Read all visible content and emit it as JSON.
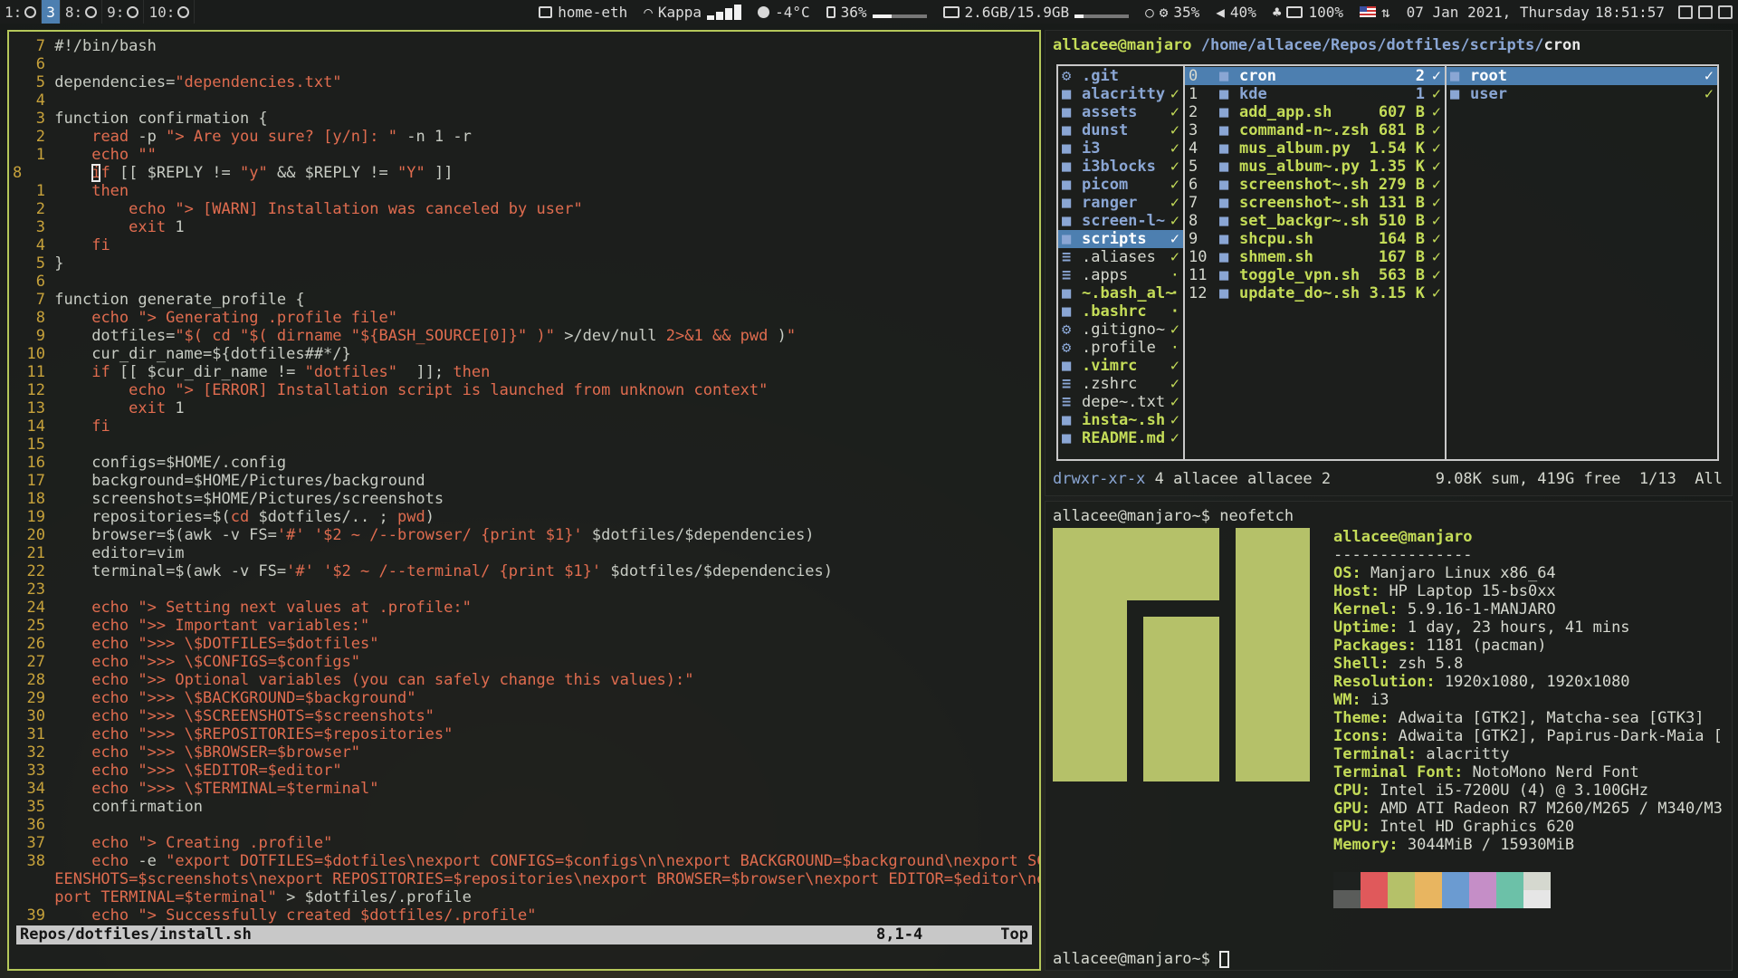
{
  "topbar": {
    "workspaces": [
      {
        "label": "1:",
        "icon": "terminal-icon",
        "active": false
      },
      {
        "label": "3",
        "icon": "",
        "active": true
      },
      {
        "label": "8:",
        "icon": "image-icon",
        "active": false
      },
      {
        "label": "9:",
        "icon": "music-icon",
        "active": false
      },
      {
        "label": "10:",
        "icon": "browser-icon",
        "active": false
      }
    ],
    "network": "home-eth",
    "wifi": "Kappa",
    "wifi_signal": 4,
    "weather": "-4°C",
    "battery_pct": "36%",
    "battery_level": 0.36,
    "memory": "2.6GB/15.9GB",
    "memory_level": 0.16,
    "cpu": "35%",
    "volume": "40%",
    "power": "100%",
    "datetime": "07 Jan 2021, Thursday",
    "time": "18:51:57"
  },
  "vim": {
    "lines": [
      {
        "n": "7",
        "h": [
          [
            "d",
            "#!/bin/bash"
          ]
        ]
      },
      {
        "n": "6",
        "h": []
      },
      {
        "n": "5",
        "h": [
          [
            "d",
            "dependencies="
          ],
          [
            "s",
            "\"dependencies.txt\""
          ]
        ]
      },
      {
        "n": "4",
        "h": []
      },
      {
        "n": "3",
        "h": [
          [
            "d",
            "function confirmation {"
          ]
        ]
      },
      {
        "n": "2",
        "h": [
          [
            "d",
            "    "
          ],
          [
            "k",
            "read"
          ],
          [
            "d",
            " -p "
          ],
          [
            "s",
            "\"> Are you sure? [y/n]: \""
          ],
          [
            "d",
            " -n 1 -r"
          ]
        ]
      },
      {
        "n": "1",
        "h": [
          [
            "d",
            "    "
          ],
          [
            "k",
            "echo"
          ],
          [
            "d",
            " "
          ],
          [
            "s",
            "\"\""
          ]
        ]
      },
      {
        "n": "8",
        "cur": true,
        "h": [
          [
            "d",
            "    "
          ],
          [
            "c",
            "i"
          ],
          [
            "k",
            "f"
          ],
          [
            "d",
            " [[ $REPLY != "
          ],
          [
            "s",
            "\"y\""
          ],
          [
            "d",
            " && $REPLY != "
          ],
          [
            "s",
            "\"Y\""
          ],
          [
            "d",
            " ]]"
          ]
        ]
      },
      {
        "n": "1",
        "h": [
          [
            "d",
            "    "
          ],
          [
            "k",
            "then"
          ]
        ]
      },
      {
        "n": "2",
        "h": [
          [
            "d",
            "        "
          ],
          [
            "k",
            "echo"
          ],
          [
            "d",
            " "
          ],
          [
            "s",
            "\"> [WARN] Installation was canceled by user\""
          ]
        ]
      },
      {
        "n": "3",
        "h": [
          [
            "d",
            "        "
          ],
          [
            "k",
            "exit"
          ],
          [
            "d",
            " 1"
          ]
        ]
      },
      {
        "n": "4",
        "h": [
          [
            "d",
            "    "
          ],
          [
            "k",
            "fi"
          ]
        ]
      },
      {
        "n": "5",
        "h": [
          [
            "d",
            "}"
          ]
        ]
      },
      {
        "n": "6",
        "h": []
      },
      {
        "n": "7",
        "h": [
          [
            "d",
            "function generate_profile {"
          ]
        ]
      },
      {
        "n": "8",
        "h": [
          [
            "d",
            "    "
          ],
          [
            "k",
            "echo"
          ],
          [
            "d",
            " "
          ],
          [
            "s",
            "\"> Generating .profile file\""
          ]
        ]
      },
      {
        "n": "9",
        "h": [
          [
            "d",
            "    dotfiles="
          ],
          [
            "s",
            "\"$( cd \"$( dirname \"${BASH_SOURCE[0]}\" )\""
          ],
          [
            "d",
            " >/dev/null "
          ],
          [
            "s",
            "2>&1 && pwd"
          ],
          [
            "d",
            " )"
          ],
          [
            "s",
            "\""
          ]
        ]
      },
      {
        "n": "10",
        "h": [
          [
            "d",
            "    cur_dir_name=${dotfiles##*/}"
          ]
        ]
      },
      {
        "n": "11",
        "h": [
          [
            "d",
            "    "
          ],
          [
            "k",
            "if"
          ],
          [
            "d",
            " [[ $cur_dir_name != "
          ],
          [
            "s",
            "\"dotfiles\""
          ],
          [
            "d",
            "  ]]; "
          ],
          [
            "k",
            "then"
          ]
        ]
      },
      {
        "n": "12",
        "h": [
          [
            "d",
            "        "
          ],
          [
            "k",
            "echo"
          ],
          [
            "d",
            " "
          ],
          [
            "s",
            "\"> [ERROR] Installation script is launched from unknown context\""
          ]
        ]
      },
      {
        "n": "13",
        "h": [
          [
            "d",
            "        "
          ],
          [
            "k",
            "exit"
          ],
          [
            "d",
            " 1"
          ]
        ]
      },
      {
        "n": "14",
        "h": [
          [
            "d",
            "    "
          ],
          [
            "k",
            "fi"
          ]
        ]
      },
      {
        "n": "15",
        "h": []
      },
      {
        "n": "16",
        "h": [
          [
            "d",
            "    configs=$HOME/.config"
          ]
        ]
      },
      {
        "n": "17",
        "h": [
          [
            "d",
            "    background=$HOME/Pictures/background"
          ]
        ]
      },
      {
        "n": "18",
        "h": [
          [
            "d",
            "    screenshots=$HOME/Pictures/screenshots"
          ]
        ]
      },
      {
        "n": "19",
        "h": [
          [
            "d",
            "    repositories=$("
          ],
          [
            "k",
            "cd"
          ],
          [
            "d",
            " $dotfiles/.. ; "
          ],
          [
            "k",
            "pwd"
          ],
          [
            "d",
            ")"
          ]
        ]
      },
      {
        "n": "20",
        "h": [
          [
            "d",
            "    browser=$(awk -v FS="
          ],
          [
            "s",
            "'#'"
          ],
          [
            "d",
            " "
          ],
          [
            "s",
            "'$2 ~ /--browser/ {print $1}'"
          ],
          [
            "d",
            " $dotfiles/$dependencies)"
          ]
        ]
      },
      {
        "n": "21",
        "h": [
          [
            "d",
            "    editor=vim"
          ]
        ]
      },
      {
        "n": "22",
        "h": [
          [
            "d",
            "    terminal=$(awk -v FS="
          ],
          [
            "s",
            "'#'"
          ],
          [
            "d",
            " "
          ],
          [
            "s",
            "'$2 ~ /--terminal/ {print $1}'"
          ],
          [
            "d",
            " $dotfiles/$dependencies)"
          ]
        ]
      },
      {
        "n": "23",
        "h": []
      },
      {
        "n": "24",
        "h": [
          [
            "d",
            "    "
          ],
          [
            "k",
            "echo"
          ],
          [
            "d",
            " "
          ],
          [
            "s",
            "\"> Setting next values at .profile:\""
          ]
        ]
      },
      {
        "n": "25",
        "h": [
          [
            "d",
            "    "
          ],
          [
            "k",
            "echo"
          ],
          [
            "d",
            " "
          ],
          [
            "s",
            "\">> Important variables:\""
          ]
        ]
      },
      {
        "n": "26",
        "h": [
          [
            "d",
            "    "
          ],
          [
            "k",
            "echo"
          ],
          [
            "d",
            " "
          ],
          [
            "s",
            "\">>> \\$DOTFILES=$dotfiles\""
          ]
        ]
      },
      {
        "n": "27",
        "h": [
          [
            "d",
            "    "
          ],
          [
            "k",
            "echo"
          ],
          [
            "d",
            " "
          ],
          [
            "s",
            "\">>> \\$CONFIGS=$configs\""
          ]
        ]
      },
      {
        "n": "28",
        "h": [
          [
            "d",
            "    "
          ],
          [
            "k",
            "echo"
          ],
          [
            "d",
            " "
          ],
          [
            "s",
            "\">> Optional variables (you can safely change this values):\""
          ]
        ]
      },
      {
        "n": "29",
        "h": [
          [
            "d",
            "    "
          ],
          [
            "k",
            "echo"
          ],
          [
            "d",
            " "
          ],
          [
            "s",
            "\">>> \\$BACKGROUND=$background\""
          ]
        ]
      },
      {
        "n": "30",
        "h": [
          [
            "d",
            "    "
          ],
          [
            "k",
            "echo"
          ],
          [
            "d",
            " "
          ],
          [
            "s",
            "\">>> \\$SCREENSHOTS=$screenshots\""
          ]
        ]
      },
      {
        "n": "31",
        "h": [
          [
            "d",
            "    "
          ],
          [
            "k",
            "echo"
          ],
          [
            "d",
            " "
          ],
          [
            "s",
            "\">>> \\$REPOSITORIES=$repositories\""
          ]
        ]
      },
      {
        "n": "32",
        "h": [
          [
            "d",
            "    "
          ],
          [
            "k",
            "echo"
          ],
          [
            "d",
            " "
          ],
          [
            "s",
            "\">>> \\$BROWSER=$browser\""
          ]
        ]
      },
      {
        "n": "33",
        "h": [
          [
            "d",
            "    "
          ],
          [
            "k",
            "echo"
          ],
          [
            "d",
            " "
          ],
          [
            "s",
            "\">>> \\$EDITOR=$editor\""
          ]
        ]
      },
      {
        "n": "34",
        "h": [
          [
            "d",
            "    "
          ],
          [
            "k",
            "echo"
          ],
          [
            "d",
            " "
          ],
          [
            "s",
            "\">>> \\$TERMINAL=$terminal\""
          ]
        ]
      },
      {
        "n": "35",
        "h": [
          [
            "d",
            "    confirmation"
          ]
        ]
      },
      {
        "n": "36",
        "h": []
      },
      {
        "n": "37",
        "h": [
          [
            "d",
            "    "
          ],
          [
            "k",
            "echo"
          ],
          [
            "d",
            " "
          ],
          [
            "s",
            "\"> Creating .profile\""
          ]
        ]
      },
      {
        "n": "38",
        "h": [
          [
            "d",
            "    "
          ],
          [
            "k",
            "echo"
          ],
          [
            "d",
            " -e "
          ],
          [
            "s",
            "\"export DOTFILES=$dotfiles\\nexport CONFIGS=$configs\\n\\nexport BACKGROUND=$background\\nexport SCR"
          ]
        ]
      },
      {
        "n": "",
        "h": [
          [
            "s",
            "EENSHOTS=$screenshots\\nexport REPOSITORIES=$repositories\\nexport BROWSER=$browser\\nexport EDITOR=$editor\\nex"
          ]
        ]
      },
      {
        "n": "",
        "h": [
          [
            "s",
            "port TERMINAL=$terminal\""
          ],
          [
            "d",
            " > $dotfiles/.profile"
          ]
        ]
      },
      {
        "n": "39",
        "h": [
          [
            "d",
            "    "
          ],
          [
            "k",
            "echo"
          ],
          [
            "d",
            " "
          ],
          [
            "s",
            "\"> Successfully created $dotfiles/.profile\""
          ]
        ]
      }
    ],
    "statusline": {
      "file": "Repos/dotfiles/install.sh",
      "position": "8,1-4",
      "scroll": "Top"
    }
  },
  "ranger": {
    "user_host": "allacee@manjaro",
    "path": " /home/allacee/Repos/dotfiles/scripts/",
    "current": "cron",
    "col1": [
      {
        "name": ".git",
        "type": "git",
        "mark": ""
      },
      {
        "name": "alacritty",
        "type": "dir",
        "mark": "✓"
      },
      {
        "name": "assets",
        "type": "dir",
        "mark": "✓"
      },
      {
        "name": "dunst",
        "type": "dir",
        "mark": "✓"
      },
      {
        "name": "i3",
        "type": "dir",
        "mark": "✓"
      },
      {
        "name": "i3blocks",
        "type": "dir",
        "mark": "✓"
      },
      {
        "name": "picom",
        "type": "dir",
        "mark": "✓"
      },
      {
        "name": "ranger",
        "type": "dir",
        "mark": "✓"
      },
      {
        "name": "screen-l~",
        "type": "dir",
        "mark": "✓"
      },
      {
        "name": "scripts",
        "type": "dir",
        "mark": "✓",
        "sel": true
      },
      {
        "name": ".aliases",
        "type": "file",
        "mark": "✓"
      },
      {
        "name": ".apps",
        "type": "file",
        "mark": "·"
      },
      {
        "name": "~.bash_al~",
        "type": "exe",
        "mark": "·"
      },
      {
        "name": ".bashrc",
        "type": "exe",
        "mark": "·"
      },
      {
        "name": ".gitigno~",
        "type": "cfg",
        "mark": "✓"
      },
      {
        "name": ".profile",
        "type": "cfg",
        "mark": "·"
      },
      {
        "name": ".vimrc",
        "type": "exe",
        "mark": "✓"
      },
      {
        "name": ".zshrc",
        "type": "file",
        "mark": "✓"
      },
      {
        "name": "depe~.txt",
        "type": "file",
        "mark": "✓"
      },
      {
        "name": "insta~.sh",
        "type": "exe",
        "mark": "✓"
      },
      {
        "name": "README.md",
        "type": "exe",
        "mark": "✓"
      }
    ],
    "col2": [
      {
        "num": "0",
        "name": "cron",
        "size": "2",
        "type": "dir",
        "sel": true
      },
      {
        "num": "1",
        "name": "kde",
        "size": "1",
        "type": "dir"
      },
      {
        "num": "2",
        "name": "add_app.sh",
        "size": "607 B",
        "type": "exe"
      },
      {
        "num": "3",
        "name": "command-n~.zsh",
        "size": "681 B",
        "type": "exe"
      },
      {
        "num": "4",
        "name": "mus_album.py",
        "size": "1.54 K",
        "type": "exe"
      },
      {
        "num": "5",
        "name": "mus_album~.py",
        "size": "1.35 K",
        "type": "exe"
      },
      {
        "num": "6",
        "name": "screenshot~.sh",
        "size": "279 B",
        "type": "exe"
      },
      {
        "num": "7",
        "name": "screenshot~.sh",
        "size": "131 B",
        "type": "exe"
      },
      {
        "num": "8",
        "name": "set_backgr~.sh",
        "size": "510 B",
        "type": "exe"
      },
      {
        "num": "9",
        "name": "shcpu.sh",
        "size": "164 B",
        "type": "exe"
      },
      {
        "num": "10",
        "name": "shmem.sh",
        "size": "167 B",
        "type": "exe"
      },
      {
        "num": "11",
        "name": "toggle_vpn.sh",
        "size": "563 B",
        "type": "exe"
      },
      {
        "num": "12",
        "name": "update_do~.sh",
        "size": "3.15 K",
        "type": "exe"
      }
    ],
    "col3": [
      {
        "name": "root",
        "type": "dir",
        "sel": true
      },
      {
        "name": "user",
        "type": "dir"
      }
    ],
    "footer_perm": "drwxr-xr-x",
    "footer_info": " 4 allacee allacee 2",
    "footer_right": "9.08K sum, 419G free  1/13  All"
  },
  "neofetch": {
    "prompt": "allacee@manjaro~$",
    "command": " neofetch",
    "title": "allacee@manjaro",
    "separator": "---------------",
    "fields": [
      {
        "k": "OS",
        "v": " Manjaro Linux x86_64"
      },
      {
        "k": "Host",
        "v": " HP Laptop 15-bs0xx"
      },
      {
        "k": "Kernel",
        "v": " 5.9.16-1-MANJARO"
      },
      {
        "k": "Uptime",
        "v": " 1 day, 23 hours, 41 mins"
      },
      {
        "k": "Packages",
        "v": " 1181 (pacman)"
      },
      {
        "k": "Shell",
        "v": " zsh 5.8"
      },
      {
        "k": "Resolution",
        "v": " 1920x1080, 1920x1080"
      },
      {
        "k": "WM",
        "v": " i3"
      },
      {
        "k": "Theme",
        "v": " Adwaita [GTK2], Matcha-sea [GTK3]"
      },
      {
        "k": "Icons",
        "v": " Adwaita [GTK2], Papirus-Dark-Maia ["
      },
      {
        "k": "Terminal",
        "v": " alacritty"
      },
      {
        "k": "Terminal Font",
        "v": " NotoMono Nerd Font"
      },
      {
        "k": "CPU",
        "v": " Intel i5-7200U (4) @ 3.100GHz"
      },
      {
        "k": "GPU",
        "v": " AMD ATI Radeon R7 M260/M265 / M340/M3"
      },
      {
        "k": "GPU",
        "v": " Intel HD Graphics 620"
      },
      {
        "k": "Memory",
        "v": " 3044MiB / 15930MiB"
      }
    ],
    "palette_top": [
      "#1e211f",
      "#e0595b",
      "#b5c169",
      "#e8b560",
      "#6b9bd1",
      "#c58ec7",
      "#6cc1a8",
      "#d5d8cf"
    ],
    "palette_bottom": [
      "#5a5c5a",
      "#e0595b",
      "#b5c169",
      "#e8b560",
      "#6b9bd1",
      "#c58ec7",
      "#6cc1a8",
      "#e6e6e6"
    ],
    "final_prompt": "allacee@manjaro~$"
  }
}
